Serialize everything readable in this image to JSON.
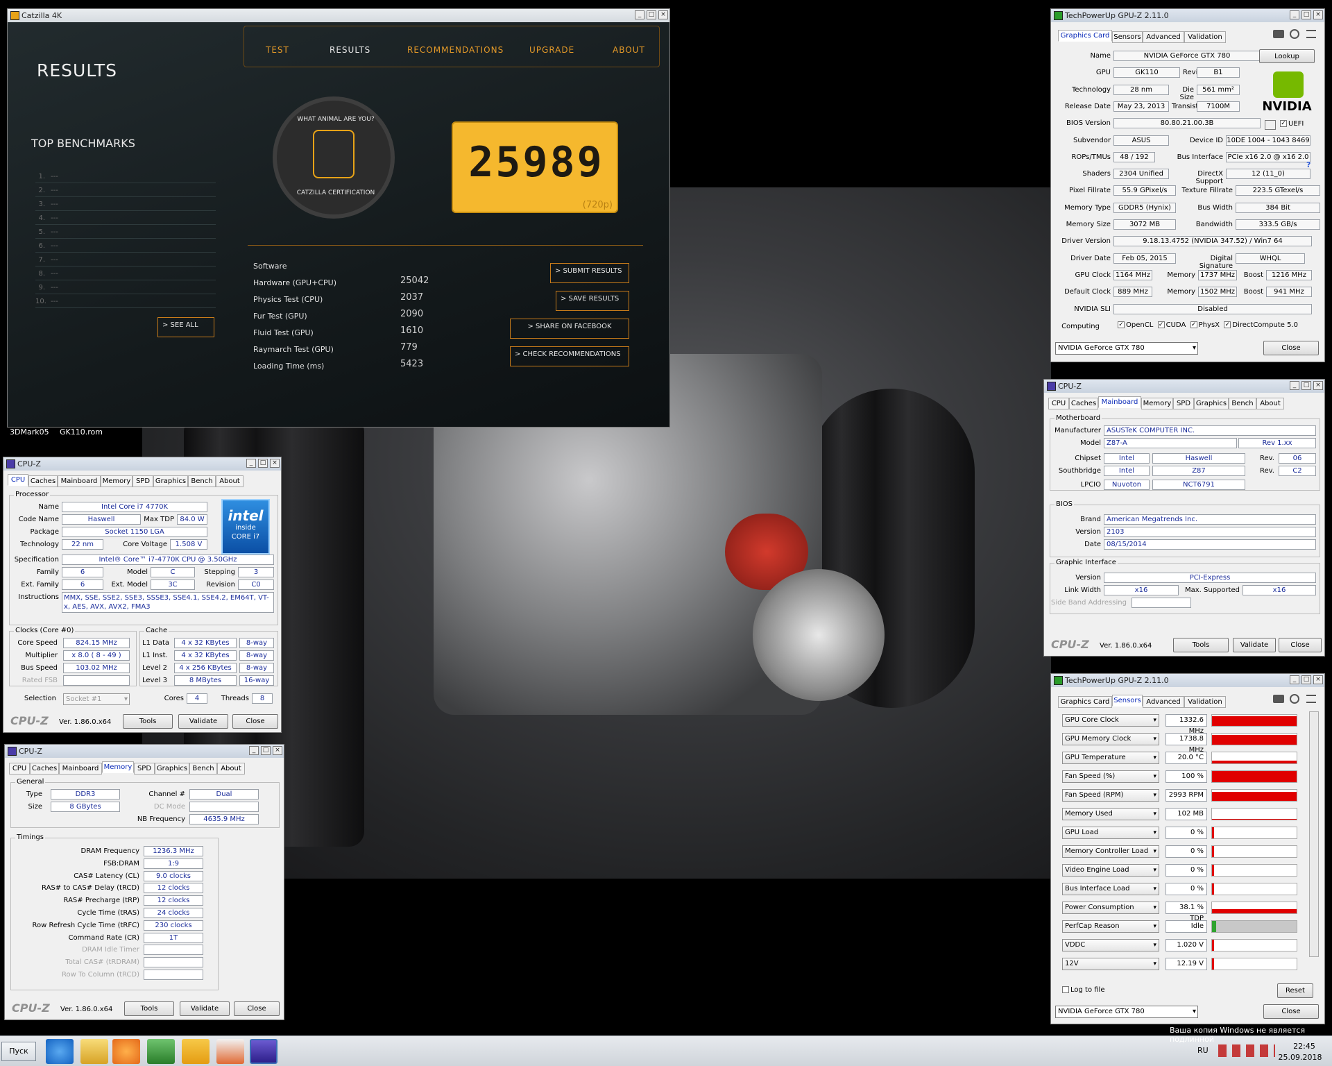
{
  "desktop": {
    "labels": [
      "3DMark05",
      "GK110.rom"
    ]
  },
  "catzilla": {
    "title": "Catzilla 4K",
    "tabs": [
      "TEST",
      "RESULTS",
      "RECOMMENDATIONS",
      "UPGRADE",
      "ABOUT"
    ],
    "heading": "RESULTS",
    "top_benchmarks": "TOP BENCHMARKS",
    "bench_rows": [
      "1.",
      "2.",
      "3.",
      "4.",
      "5.",
      "6.",
      "7.",
      "8.",
      "9.",
      "10."
    ],
    "bench_placeholder": "---",
    "see_all": "> SEE ALL",
    "badge_top": "WHAT ANIMAL ARE YOU?",
    "badge_bottom": "CATZILLA CERTIFICATION",
    "score": "25989",
    "resolution": "(720p)",
    "software": "Software",
    "results": [
      {
        "label": "Hardware (GPU+CPU)",
        "value": "25042"
      },
      {
        "label": "Physics Test (CPU)",
        "value": "2037"
      },
      {
        "label": "Fur Test (GPU)",
        "value": "2090"
      },
      {
        "label": "Fluid Test (GPU)",
        "value": "1610"
      },
      {
        "label": "Raymarch Test (GPU)",
        "value": "779"
      },
      {
        "label": "Loading Time (ms)",
        "value": "5423"
      }
    ],
    "buttons": [
      "> SUBMIT RESULTS",
      "> SAVE RESULTS",
      "> SHARE ON FACEBOOK",
      "> CHECK RECOMMENDATIONS"
    ]
  },
  "gpuz1": {
    "title": "TechPowerUp GPU-Z 2.11.0",
    "tabs": [
      "Graphics Card",
      "Sensors",
      "Advanced",
      "Validation"
    ],
    "rows": [
      {
        "l": "Name",
        "v": "NVIDIA GeForce GTX 780"
      },
      {
        "l": "GPU",
        "v": "GK110",
        "l2": "Revision",
        "v2": "B1"
      },
      {
        "l": "Technology",
        "v": "28 nm",
        "l2": "Die Size",
        "v2": "561 mm²"
      },
      {
        "l": "Release Date",
        "v": "May 23, 2013",
        "l2": "Transistors",
        "v2": "7100M"
      },
      {
        "l": "BIOS Version",
        "v": "80.80.21.00.3B"
      },
      {
        "l": "Subvendor",
        "v": "ASUS",
        "l2": "Device ID",
        "v2": "10DE 1004 - 1043 8469"
      },
      {
        "l": "ROPs/TMUs",
        "v": "48 / 192",
        "l2": "Bus Interface",
        "v2": "PCIe x16 2.0 @ x16 2.0"
      },
      {
        "l": "Shaders",
        "v": "2304 Unified",
        "l2": "DirectX Support",
        "v2": "12 (11_0)"
      },
      {
        "l": "Pixel Fillrate",
        "v": "55.9 GPixel/s",
        "l2": "Texture Fillrate",
        "v2": "223.5 GTexel/s"
      },
      {
        "l": "Memory Type",
        "v": "GDDR5 (Hynix)",
        "l2": "Bus Width",
        "v2": "384 Bit"
      },
      {
        "l": "Memory Size",
        "v": "3072 MB",
        "l2": "Bandwidth",
        "v2": "333.5 GB/s"
      },
      {
        "l": "Driver Version",
        "v": "9.18.13.4752 (NVIDIA 347.52) / Win7 64"
      },
      {
        "l": "Driver Date",
        "v": "Feb 05, 2015",
        "l2": "Digital Signature",
        "v2": "WHQL"
      },
      {
        "l": "GPU Clock",
        "v": "1164 MHz",
        "l2": "Memory",
        "v2": "1737 MHz",
        "l3": "Boost",
        "v3": "1216 MHz"
      },
      {
        "l": "Default Clock",
        "v": "889 MHz",
        "l2": "Memory",
        "v2": "1502 MHz",
        "l3": "Boost",
        "v3": "941 MHz"
      },
      {
        "l": "NVIDIA SLI",
        "v": "Disabled"
      }
    ],
    "lookup": "Lookup",
    "uefi": "UEFI",
    "computing_label": "Computing",
    "computing": [
      "OpenCL",
      "CUDA",
      "PhysX",
      "DirectCompute 5.0"
    ],
    "select": "NVIDIA GeForce GTX 780",
    "close": "Close",
    "vendor": "NVIDIA"
  },
  "cpuz_mb": {
    "title": "CPU-Z",
    "tabs": [
      "CPU",
      "Caches",
      "Mainboard",
      "Memory",
      "SPD",
      "Graphics",
      "Bench",
      "About"
    ],
    "group_mb": "Motherboard",
    "manufacturer_l": "Manufacturer",
    "manufacturer": "ASUSTeK COMPUTER INC.",
    "model_l": "Model",
    "model": "Z87-A",
    "model_rev": "Rev 1.xx",
    "chipset_l": "Chipset",
    "chipset": "Intel",
    "chipset2": "Haswell",
    "rev_l": "Rev.",
    "chipset_rev": "06",
    "south_l": "Southbridge",
    "south": "Intel",
    "south2": "Z87",
    "south_rev": "C2",
    "lpcio_l": "LPCIO",
    "lpcio": "Nuvoton",
    "lpcio2": "NCT6791",
    "group_bios": "BIOS",
    "brand_l": "Brand",
    "brand": "American Megatrends Inc.",
    "version_l": "Version",
    "version": "2103",
    "date_l": "Date",
    "date": "08/15/2014",
    "group_gi": "Graphic Interface",
    "gi_version_l": "Version",
    "gi_version": "PCI-Express",
    "link_l": "Link Width",
    "link": "x16",
    "max_l": "Max. Supported",
    "max": "x16",
    "sba": "Side Band Addressing",
    "logo": "CPU-Z",
    "ver": "Ver. 1.86.0.x64",
    "tools": "Tools",
    "validate": "Validate",
    "close": "Close"
  },
  "cpuz_cpu": {
    "title": "CPU-Z",
    "tabs": [
      "CPU",
      "Caches",
      "Mainboard",
      "Memory",
      "SPD",
      "Graphics",
      "Bench",
      "About"
    ],
    "group_proc": "Processor",
    "name_l": "Name",
    "name": "Intel Core i7 4770K",
    "code_l": "Code Name",
    "code": "Haswell",
    "tdp_l": "Max TDP",
    "tdp": "84.0 W",
    "pkg_l": "Package",
    "pkg": "Socket 1150 LGA",
    "tech_l": "Technology",
    "tech": "22 nm",
    "volt_l": "Core Voltage",
    "volt": "1.508 V",
    "spec_l": "Specification",
    "spec": "Intel® Core™ i7-4770K CPU @ 3.50GHz",
    "fam_l": "Family",
    "fam": "6",
    "mod_l": "Model",
    "mod": "C",
    "step_l": "Stepping",
    "step": "3",
    "efam_l": "Ext. Family",
    "efam": "6",
    "emod_l": "Ext. Model",
    "emod": "3C",
    "rev_l": "Revision",
    "rev": "C0",
    "instr_l": "Instructions",
    "instr": "MMX, SSE, SSE2, SSE3, SSSE3, SSE4.1, SSE4.2, EM64T, VT-x, AES, AVX, AVX2, FMA3",
    "group_clk": "Clocks (Core #0)",
    "cs_l": "Core Speed",
    "cs": "824.15 MHz",
    "mult_l": "Multiplier",
    "mult": "x 8.0 ( 8 - 49 )",
    "bus_l": "Bus Speed",
    "bus": "103.02 MHz",
    "fsb_l": "Rated FSB",
    "group_cache": "Cache",
    "l1d_l": "L1 Data",
    "l1d": "4 x 32 KBytes",
    "l1d_w": "8-way",
    "l1i_l": "L1 Inst.",
    "l1i": "4 x 32 KBytes",
    "l1i_w": "8-way",
    "l2_l": "Level 2",
    "l2": "4 x 256 KBytes",
    "l2_w": "8-way",
    "l3_l": "Level 3",
    "l3": "8 MBytes",
    "l3_w": "16-way",
    "sel_l": "Selection",
    "sel": "Socket #1",
    "cores_l": "Cores",
    "cores": "4",
    "thr_l": "Threads",
    "thr": "8",
    "intel": "intel",
    "inside": "inside",
    "core": "CORE i7",
    "logo": "CPU-Z",
    "ver": "Ver. 1.86.0.x64",
    "tools": "Tools",
    "validate": "Validate",
    "close": "Close"
  },
  "cpuz_mem": {
    "title": "CPU-Z",
    "tabs": [
      "CPU",
      "Caches",
      "Mainboard",
      "Memory",
      "SPD",
      "Graphics",
      "Bench",
      "About"
    ],
    "group_gen": "General",
    "type_l": "Type",
    "type": "DDR3",
    "chan_l": "Channel #",
    "chan": "Dual",
    "size_l": "Size",
    "size": "8 GBytes",
    "dc_l": "DC Mode",
    "nb_l": "NB Frequency",
    "nb": "4635.9 MHz",
    "group_tim": "Timings",
    "timings": [
      {
        "l": "DRAM Frequency",
        "v": "1236.3 MHz"
      },
      {
        "l": "FSB:DRAM",
        "v": "1:9"
      },
      {
        "l": "CAS# Latency (CL)",
        "v": "9.0 clocks"
      },
      {
        "l": "RAS# to CAS# Delay (tRCD)",
        "v": "12 clocks"
      },
      {
        "l": "RAS# Precharge (tRP)",
        "v": "12 clocks"
      },
      {
        "l": "Cycle Time (tRAS)",
        "v": "24 clocks"
      },
      {
        "l": "Row Refresh Cycle Time (tRFC)",
        "v": "230 clocks"
      },
      {
        "l": "Command Rate (CR)",
        "v": "1T"
      },
      {
        "l": "DRAM Idle Timer",
        "v": ""
      },
      {
        "l": "Total CAS# (tRDRAM)",
        "v": ""
      },
      {
        "l": "Row To Column (tRCD)",
        "v": ""
      }
    ],
    "logo": "CPU-Z",
    "ver": "Ver. 1.86.0.x64",
    "tools": "Tools",
    "validate": "Validate",
    "close": "Close"
  },
  "gpuz2": {
    "title": "TechPowerUp GPU-Z 2.11.0",
    "tabs": [
      "Graphics Card",
      "Sensors",
      "Advanced",
      "Validation"
    ],
    "sensors": [
      {
        "n": "GPU Core Clock",
        "v": "1332.6 MHz",
        "fill": 0.9
      },
      {
        "n": "GPU Memory Clock",
        "v": "1738.8 MHz",
        "fill": 0.85
      },
      {
        "n": "GPU Temperature",
        "v": "20.0 °C",
        "fill": 0.25
      },
      {
        "n": "Fan Speed (%)",
        "v": "100 %",
        "fill": 1.0
      },
      {
        "n": "Fan Speed (RPM)",
        "v": "2993 RPM",
        "fill": 0.8
      },
      {
        "n": "Memory Used",
        "v": "102 MB",
        "fill": 0.05
      },
      {
        "n": "GPU Load",
        "v": "0 %",
        "fill": 0.0
      },
      {
        "n": "Memory Controller Load",
        "v": "0 %",
        "fill": 0.0
      },
      {
        "n": "Video Engine Load",
        "v": "0 %",
        "fill": 0.0
      },
      {
        "n": "Bus Interface Load",
        "v": "0 %",
        "fill": 0.0
      },
      {
        "n": "Power Consumption",
        "v": "38.1 % TDP",
        "fill": 0.38
      },
      {
        "n": "PerfCap Reason",
        "v": "Idle",
        "fill": 0.0
      },
      {
        "n": "VDDC",
        "v": "1.020 V",
        "fill": 0.0
      },
      {
        "n": "12V",
        "v": "12.19 V",
        "fill": 0.0
      }
    ],
    "log": "Log to file",
    "reset": "Reset",
    "select": "NVIDIA GeForce GTX 780",
    "close": "Close"
  },
  "taskbar": {
    "start": "Пуск",
    "lang": "RU",
    "time": "22:45",
    "date": "25.09.2018",
    "watermark": "Ваша копия Windows не является подлинной"
  }
}
